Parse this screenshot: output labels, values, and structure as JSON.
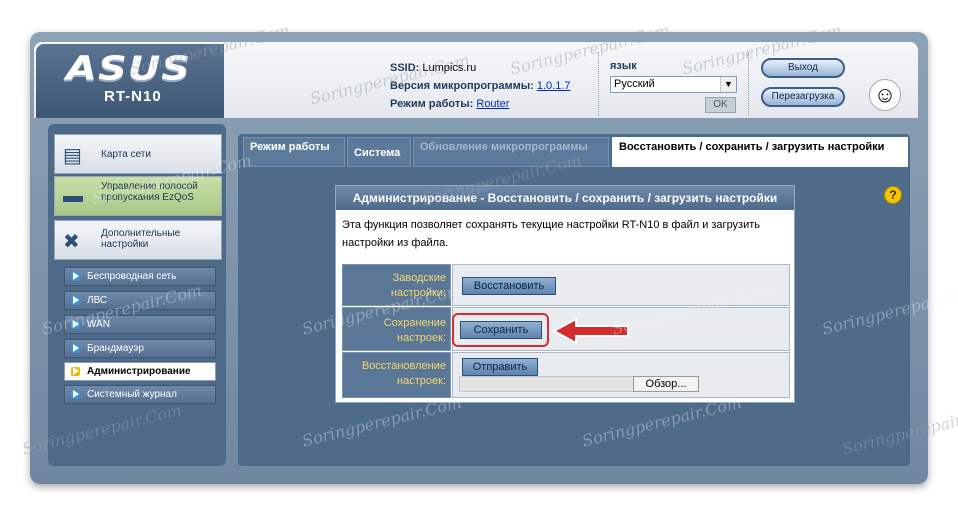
{
  "header": {
    "brand": "ASUS",
    "model": "RT-N10",
    "ssid_label": "SSID:",
    "ssid_value": "Lumpics.ru",
    "firmware_label": "Версия микропрограммы:",
    "firmware_value": "1.0.1.7",
    "mode_label": "Режим работы:",
    "mode_value": "Router",
    "language_label": "язык",
    "language_value": "Русский",
    "ok_label": "OK",
    "logout_label": "Выход",
    "reboot_label": "Перезагрузка"
  },
  "sidebar": {
    "main_items": [
      {
        "label": "Карта сети",
        "icon": "network-map-icon"
      },
      {
        "label": "Управление полосой пропускания EzQoS",
        "icon": "qos-icon"
      },
      {
        "label": "Дополнительные настройки",
        "icon": "tools-icon"
      }
    ],
    "sub_items": [
      {
        "label": "Беспроводная сеть"
      },
      {
        "label": "ЛВС"
      },
      {
        "label": "WAN"
      },
      {
        "label": "Брандмауэр"
      },
      {
        "label": "Администрирование"
      },
      {
        "label": "Системный журнал"
      }
    ]
  },
  "tabs": [
    {
      "label": "Режим работы"
    },
    {
      "label": "Система"
    },
    {
      "label": "Обновление микропрограммы"
    },
    {
      "label": "Восстановить / сохранить / загрузить настройки"
    }
  ],
  "dialog": {
    "title": "Администрирование - Восстановить / сохранить / загрузить настройки",
    "description": "Эта функция позволяет сохранять текущие настройки RT-N10 в файл и загрузить настройки из файла.",
    "rows": [
      {
        "label": "Заводские настройки:",
        "button": "Восстановить"
      },
      {
        "label": "Сохранение настроек:",
        "button": "Сохранить"
      },
      {
        "label": "Восстановление настроек:",
        "button": "Отправить",
        "browse": "Обзор..."
      }
    ]
  },
  "watermark": "Soringperepair.Com",
  "colors": {
    "accent": "#4c6a8a",
    "highlight": "#d42d2d",
    "label_yellow": "#f2d86a"
  }
}
